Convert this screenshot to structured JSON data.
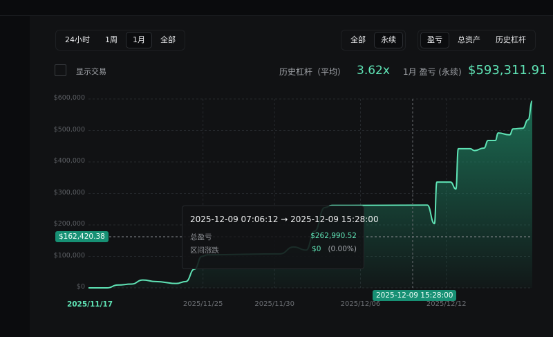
{
  "range_tabs": [
    {
      "label": "24小时",
      "active": false
    },
    {
      "label": "1周",
      "active": false
    },
    {
      "label": "1月",
      "active": true
    },
    {
      "label": "全部",
      "active": false
    }
  ],
  "market_tabs": [
    {
      "label": "全部",
      "active": false
    },
    {
      "label": "永续",
      "active": true
    }
  ],
  "metric_tabs": [
    {
      "label": "盈亏",
      "active": true
    },
    {
      "label": "总资产",
      "active": false
    },
    {
      "label": "历史杠杆",
      "active": false
    }
  ],
  "show_trades": {
    "label": "显示交易",
    "checked": false
  },
  "stats": {
    "leverage_label": "历史杠杆（平均）",
    "leverage_value": "3.62x",
    "pnl_label": "1月 盈亏 (永续)",
    "pnl_value": "$593,311.91"
  },
  "tooltip": {
    "range": "2025-12-09 07:06:12 → 2025-12-09 15:28:00",
    "total_pnl_label": "总盈亏",
    "total_pnl_value": "$262,990.52",
    "change_label": "区间涨跌",
    "change_value": "$0",
    "change_pct": "(0.00%)"
  },
  "crosshair": {
    "y_label": "$162,420.38",
    "y_value": 162420.38,
    "x_label": "2025-12-09 15:28:00",
    "x_value": "2025-12-09T15:28:00"
  },
  "colors": {
    "accent": "#5fe3b5",
    "pill": "#179074",
    "background": "#111214"
  },
  "chart_data": {
    "type": "area",
    "x_range": [
      "2025-11-17T00:00",
      "2025-12-18T00:00"
    ],
    "ylim": [
      0,
      600000
    ],
    "grid": true,
    "yticks": [
      {
        "v": 0,
        "label": "$0"
      },
      {
        "v": 100000,
        "label": "$100,000"
      },
      {
        "v": 200000,
        "label": "$200,000"
      },
      {
        "v": 300000,
        "label": "$300,000"
      },
      {
        "v": 400000,
        "label": "$400,000"
      },
      {
        "v": 500000,
        "label": "$500,000"
      },
      {
        "v": 600000,
        "label": "$600,000"
      }
    ],
    "xticks": [
      {
        "x": "2025-11-17T00:00",
        "label": "2025/11/17",
        "highlight": true
      },
      {
        "x": "2025-11-25T00:00",
        "label": "2025/11/25"
      },
      {
        "x": "2025-11-30T00:00",
        "label": "2025/11/30"
      },
      {
        "x": "2025-12-06T00:00",
        "label": "2025/12/06"
      },
      {
        "x": "2025-12-12T00:00",
        "label": "2025/12/12"
      }
    ],
    "points": [
      [
        "2025-11-17T00:00",
        0
      ],
      [
        "2025-11-18T07:00",
        0
      ],
      [
        "2025-11-19T01:00",
        9000
      ],
      [
        "2025-11-20T00:00",
        12000
      ],
      [
        "2025-11-20T19:00",
        25000
      ],
      [
        "2025-11-21T17:00",
        20000
      ],
      [
        "2025-11-23T03:00",
        14000
      ],
      [
        "2025-11-23T19:00",
        20000
      ],
      [
        "2025-11-24T10:00",
        60000
      ],
      [
        "2025-11-24T22:00",
        100000
      ],
      [
        "2025-11-25T07:00",
        105000
      ],
      [
        "2025-11-30T09:00",
        108000
      ],
      [
        "2025-12-01T08:00",
        130000
      ],
      [
        "2025-12-02T05:00",
        120000
      ],
      [
        "2025-12-02T19:00",
        180000
      ],
      [
        "2025-12-03T12:00",
        255000
      ],
      [
        "2025-12-04T00:00",
        262000
      ],
      [
        "2025-12-10T16:00",
        262990
      ],
      [
        "2025-12-11T04:00",
        204000
      ],
      [
        "2025-12-11T08:00",
        336000
      ],
      [
        "2025-12-12T07:00",
        336000
      ],
      [
        "2025-12-12T16:00",
        314000
      ],
      [
        "2025-12-12T20:00",
        442000
      ],
      [
        "2025-12-13T16:00",
        442000
      ],
      [
        "2025-12-13T23:00",
        436000
      ],
      [
        "2025-12-14T15:00",
        444000
      ],
      [
        "2025-12-14T22:00",
        468000
      ],
      [
        "2025-12-15T10:00",
        468000
      ],
      [
        "2025-12-15T15:00",
        492000
      ],
      [
        "2025-12-16T10:00",
        486000
      ],
      [
        "2025-12-16T16:00",
        505000
      ],
      [
        "2025-12-17T08:00",
        507000
      ],
      [
        "2025-12-17T17:00",
        534000
      ],
      [
        "2025-12-18T00:00",
        593311.91
      ]
    ]
  }
}
